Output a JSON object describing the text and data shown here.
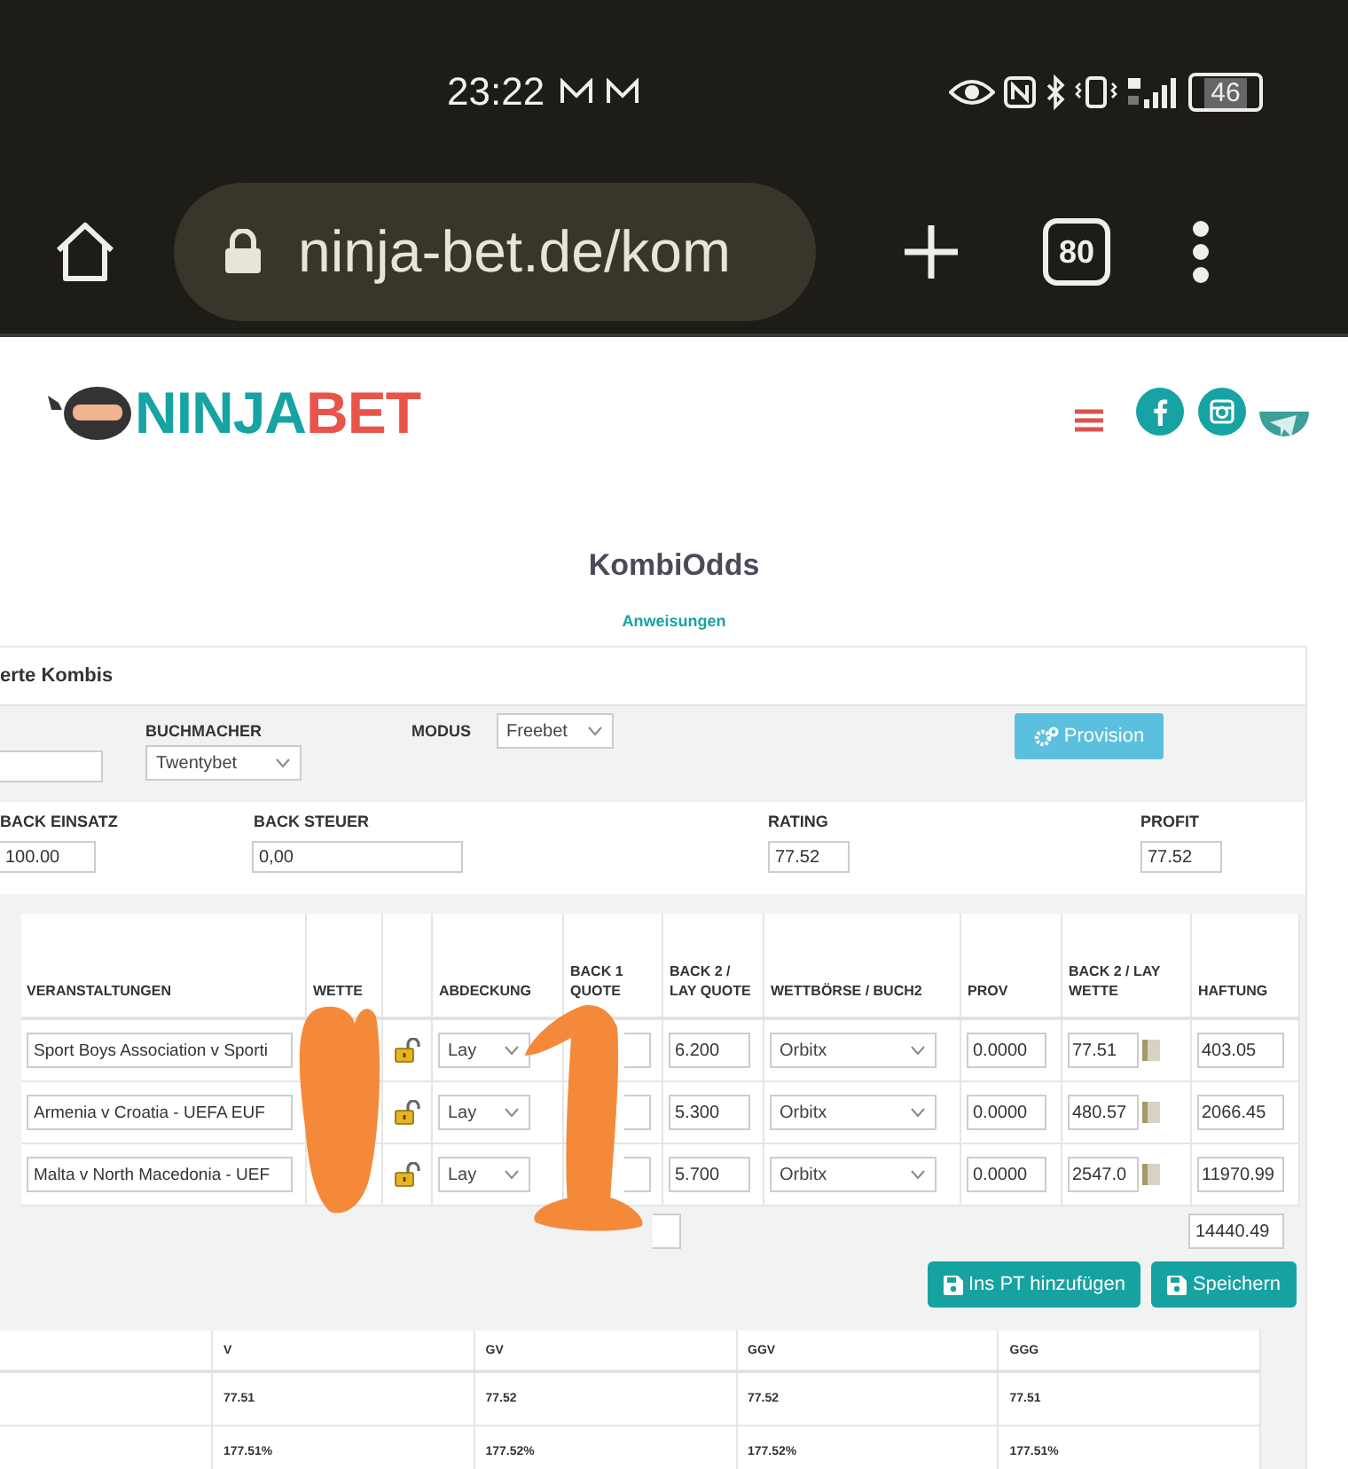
{
  "status_bar": {
    "time": "23:22",
    "battery": "46"
  },
  "browser": {
    "url": "ninja-bet.de/kom",
    "tab_count": "80"
  },
  "site": {
    "logo": [
      {
        "text": "NINJA",
        "color": "#17a3a3"
      },
      {
        "text": "BET",
        "color": "#e8544a"
      }
    ]
  },
  "page": {
    "title": "KombiOdds",
    "link": "Anweisungen"
  },
  "panel": {
    "heading": "erte Kombis",
    "settings": {
      "bookmaker_label": "BUCHMACHER",
      "bookmaker": "Twentybet",
      "mode_label": "MODUS",
      "mode": "Freebet",
      "provision_button": "Provision"
    },
    "stake": [
      {
        "label": "BACK EINSATZ",
        "value": "100.00"
      },
      {
        "label": "BACK STEUER",
        "value": "0,00"
      },
      {
        "label": "RATING",
        "value": "77.52"
      },
      {
        "label": "PROFIT",
        "value": "77.52"
      }
    ],
    "table": {
      "columns": [
        "VERANSTALTUNGEN",
        "WETTE",
        "ABDECKUNG",
        "BACK 1 QUOTE",
        "BACK 2 / LAY QUOTE",
        "WETTBÖRSE / BUCH2",
        "PROV",
        "BACK 2 / LAY WETTE",
        "HAFTUNG"
      ],
      "rows": [
        {
          "event": "Sport Boys Association v Sporti",
          "cover": "Lay",
          "back2_odds": "6.200",
          "exchange": "Orbitx",
          "commission": "0.0000",
          "lay_stake": "77.51",
          "liability": "403.05"
        },
        {
          "event": "Armenia v Croatia - UEFA EUF",
          "cover": "Lay",
          "back2_odds": "5.300",
          "exchange": "Orbitx",
          "commission": "0.0000",
          "lay_stake": "480.57",
          "liability": "2066.45"
        },
        {
          "event": "Malta v North Macedonia - UEF",
          "cover": "Lay",
          "back2_odds": "5.700",
          "exchange": "Orbitx",
          "commission": "0.0000",
          "lay_stake": "2547.0",
          "liability": "11970.99"
        }
      ],
      "total_liability": "14440.49"
    },
    "buttons": [
      "Ins PT hinzufügen",
      "Speichern"
    ],
    "results": {
      "columns": [
        "V",
        "GV",
        "GGV",
        "GGG"
      ],
      "rows": [
        [
          "77.51",
          "77.52",
          "77.52",
          "77.51"
        ],
        [
          "177.51%",
          "177.52%",
          "177.52%",
          "177.51%"
        ]
      ]
    }
  }
}
